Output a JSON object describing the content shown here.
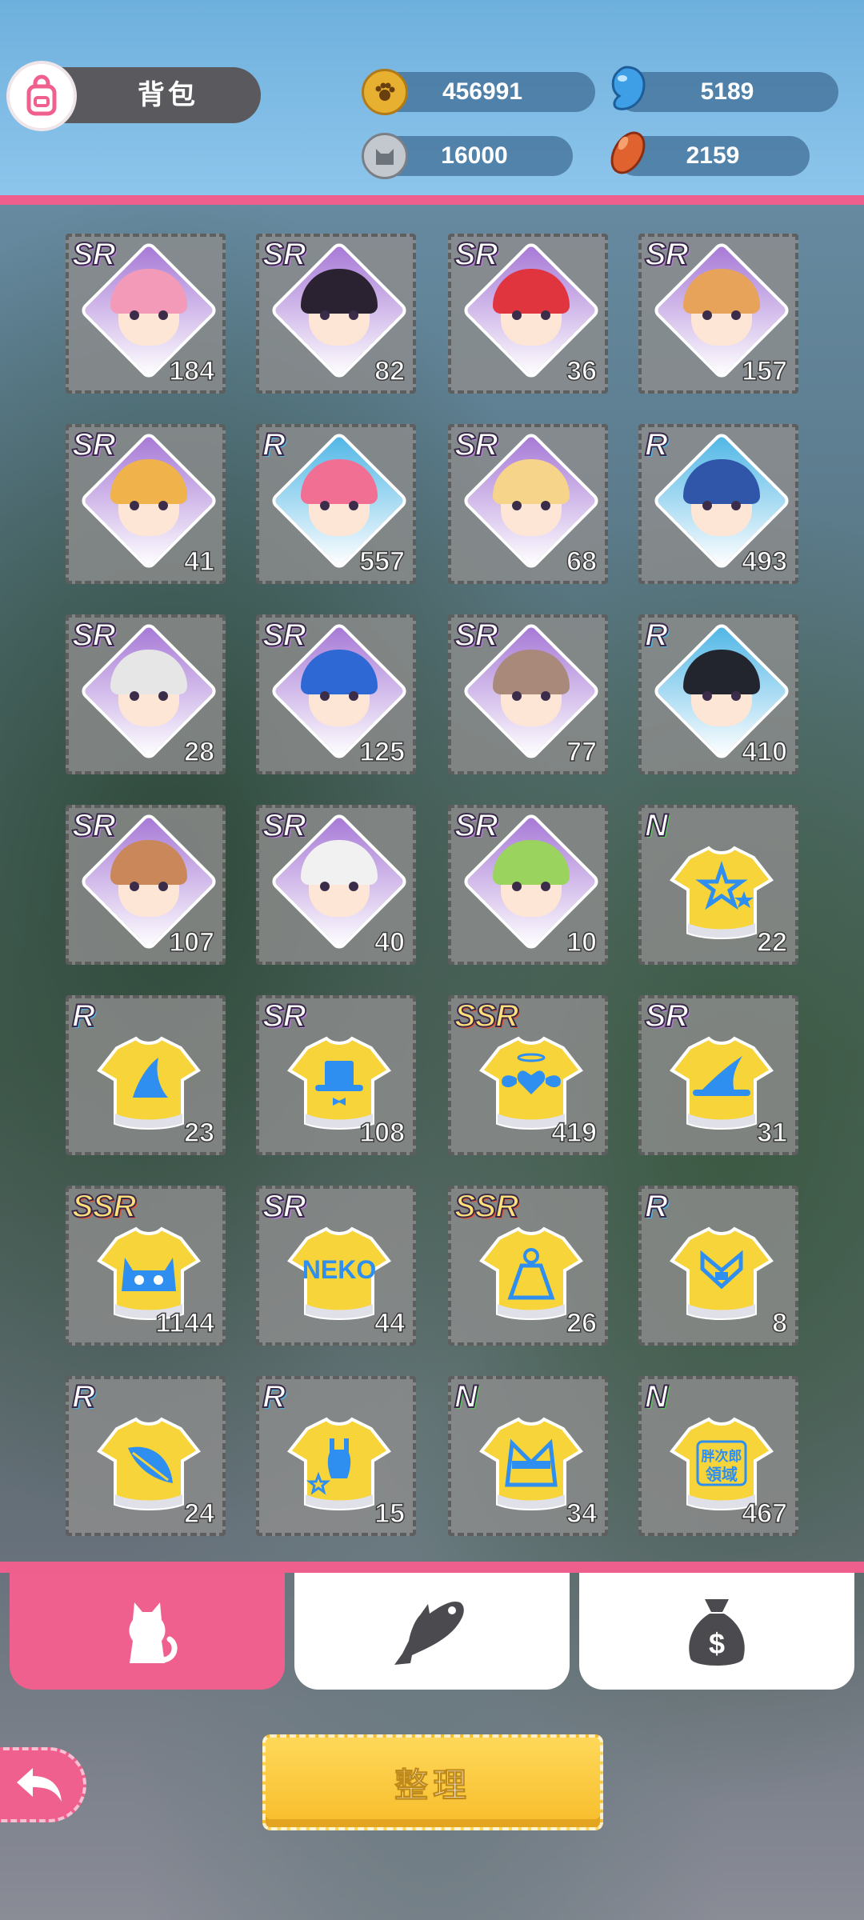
{
  "header": {
    "bag_title": "背包",
    "currencies": [
      {
        "name": "paw-coin-icon",
        "value": "456991",
        "color": "#e8b030"
      },
      {
        "name": "blue-gem-icon",
        "value": "5189",
        "color": "#3f9fe6"
      },
      {
        "name": "cat-token-icon",
        "value": "16000",
        "color": "#9aa0a8"
      },
      {
        "name": "bean-icon",
        "value": "2159",
        "color": "#e0622e"
      }
    ]
  },
  "items": [
    {
      "rarity": "SR",
      "count": "184",
      "kind": "character",
      "gem": "#a678d6",
      "hair": "#f39ab8"
    },
    {
      "rarity": "SR",
      "count": "82",
      "kind": "character",
      "gem": "#a678d6",
      "hair": "#2a2230"
    },
    {
      "rarity": "SR",
      "count": "36",
      "kind": "character",
      "gem": "#a678d6",
      "hair": "#e0343e"
    },
    {
      "rarity": "SR",
      "count": "157",
      "kind": "character",
      "gem": "#a678d6",
      "hair": "#e7a35a"
    },
    {
      "rarity": "SR",
      "count": "41",
      "kind": "character",
      "gem": "#a678d6",
      "hair": "#f0b24a"
    },
    {
      "rarity": "R",
      "count": "557",
      "kind": "character",
      "gem": "#4fb6e6",
      "hair": "#f06f93"
    },
    {
      "rarity": "SR",
      "count": "68",
      "kind": "character",
      "gem": "#a678d6",
      "hair": "#f6d48a"
    },
    {
      "rarity": "R",
      "count": "493",
      "kind": "character",
      "gem": "#4fb6e6",
      "hair": "#2f56a8"
    },
    {
      "rarity": "SR",
      "count": "28",
      "kind": "character",
      "gem": "#a678d6",
      "hair": "#e6e6e6"
    },
    {
      "rarity": "SR",
      "count": "125",
      "kind": "character",
      "gem": "#a678d6",
      "hair": "#2e68d4"
    },
    {
      "rarity": "SR",
      "count": "77",
      "kind": "character",
      "gem": "#a678d6",
      "hair": "#a8897a"
    },
    {
      "rarity": "R",
      "count": "410",
      "kind": "character",
      "gem": "#4fb6e6",
      "hair": "#23252e"
    },
    {
      "rarity": "SR",
      "count": "107",
      "kind": "character",
      "gem": "#a678d6",
      "hair": "#c9875a"
    },
    {
      "rarity": "SR",
      "count": "40",
      "kind": "character",
      "gem": "#a678d6",
      "hair": "#f1f1f1"
    },
    {
      "rarity": "SR",
      "count": "10",
      "kind": "character",
      "gem": "#a678d6",
      "hair": "#9ad45e"
    },
    {
      "rarity": "N",
      "count": "22",
      "kind": "shirt",
      "emblem": "stars"
    },
    {
      "rarity": "R",
      "count": "23",
      "kind": "shirt",
      "emblem": "shark"
    },
    {
      "rarity": "SR",
      "count": "108",
      "kind": "shirt",
      "emblem": "top-hat"
    },
    {
      "rarity": "SSR",
      "count": "419",
      "kind": "shirt",
      "emblem": "winged-heart"
    },
    {
      "rarity": "SR",
      "count": "31",
      "kind": "shirt",
      "emblem": "witch-hat"
    },
    {
      "rarity": "SSR",
      "count": "1144",
      "kind": "shirt",
      "emblem": "cat-face"
    },
    {
      "rarity": "SR",
      "count": "44",
      "kind": "shirt",
      "emblem": "neko",
      "emblem_text": "NEKO"
    },
    {
      "rarity": "SSR",
      "count": "26",
      "kind": "shirt",
      "emblem": "dress"
    },
    {
      "rarity": "R",
      "count": "8",
      "kind": "shirt",
      "emblem": "sailor"
    },
    {
      "rarity": "R",
      "count": "24",
      "kind": "shirt",
      "emblem": "leaf"
    },
    {
      "rarity": "R",
      "count": "15",
      "kind": "shirt",
      "emblem": "swimsuit"
    },
    {
      "rarity": "N",
      "count": "34",
      "kind": "shirt",
      "emblem": "kimono"
    },
    {
      "rarity": "N",
      "count": "467",
      "kind": "shirt",
      "emblem": "text-logo",
      "emblem_text": "胖次郎\n領域"
    }
  ],
  "tabs": [
    {
      "name": "tab-cats",
      "icon": "cat-icon",
      "active": true
    },
    {
      "name": "tab-fish",
      "icon": "fish-icon",
      "active": false
    },
    {
      "name": "tab-money",
      "icon": "money-bag-icon",
      "active": false
    }
  ],
  "footer": {
    "back_icon": "back-arrow-icon",
    "sort_label": "整理"
  },
  "colors": {
    "accent_pink": "#ee5f8e",
    "header_blue": "#7dbde6",
    "button_yellow": "#f7bd2a"
  }
}
